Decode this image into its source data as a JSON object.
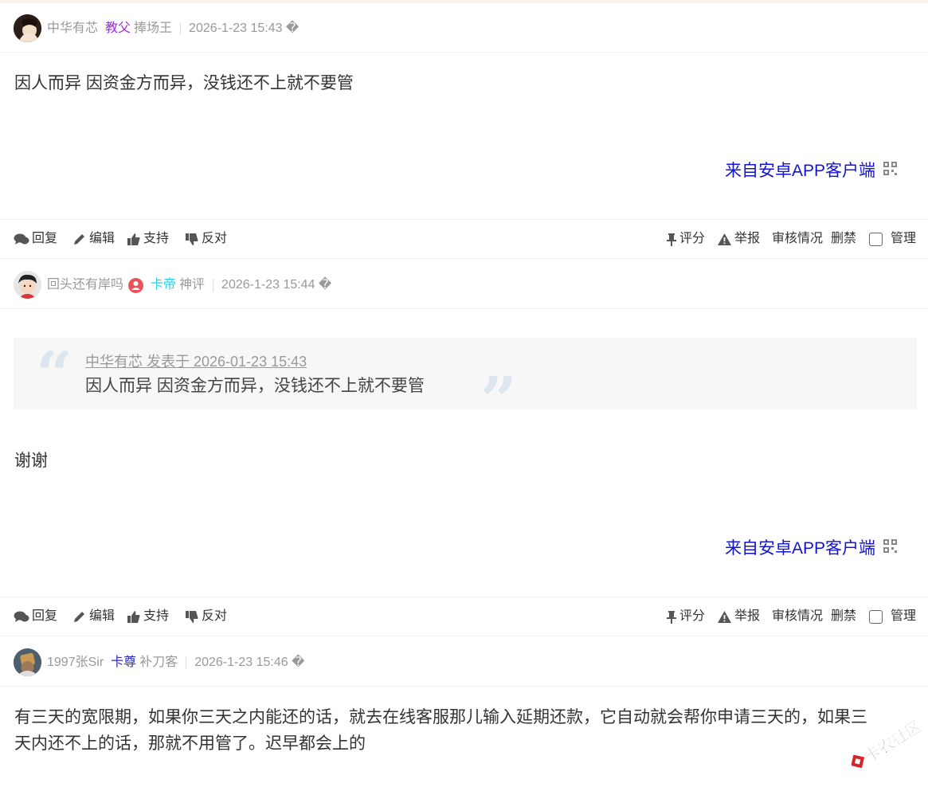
{
  "posts": [
    {
      "username": "中华有芯",
      "title_primary": "教父",
      "title_primary_color": "#9b30d9",
      "title_secondary": "捧场王",
      "time": "2026-1-23 15:43 �",
      "content": "因人而异 因资金方而异，没钱还不上就不要管",
      "from_app": "来自安卓APP客户端"
    },
    {
      "username": "回头还有岸吗",
      "title_primary": "卡帝",
      "title_primary_color": "#26d4e8",
      "title_secondary": "神评",
      "time": "2026-1-23 15:44 �",
      "quote_author": "中华有芯 发表于 2026-01-23 15:43",
      "quote_text": "因人而异 因资金方而异，没钱还不上就不要管",
      "content": "谢谢",
      "from_app": "来自安卓APP客户端"
    },
    {
      "username": "1997张Sir",
      "title_primary": "卡尊",
      "title_primary_color": "#2a2ad0",
      "title_secondary": "补刀客",
      "time": "2026-1-23 15:46 �",
      "content_line1": "有三天的宽限期，如果你三天之内能还的话，就去在线客服那儿输入延期还款，它自动就会帮你申请三天的，如果三",
      "content_line2": "天内还不上的话，那就不用管了。迟早都会上的"
    }
  ],
  "actions": {
    "reply": "回复",
    "edit": "编辑",
    "support": "支持",
    "oppose": "反对",
    "rate": "评分",
    "report": "举报",
    "review": "审核情况",
    "ban": "删禁",
    "manage": "管理"
  },
  "watermark_text": "卡农社区"
}
